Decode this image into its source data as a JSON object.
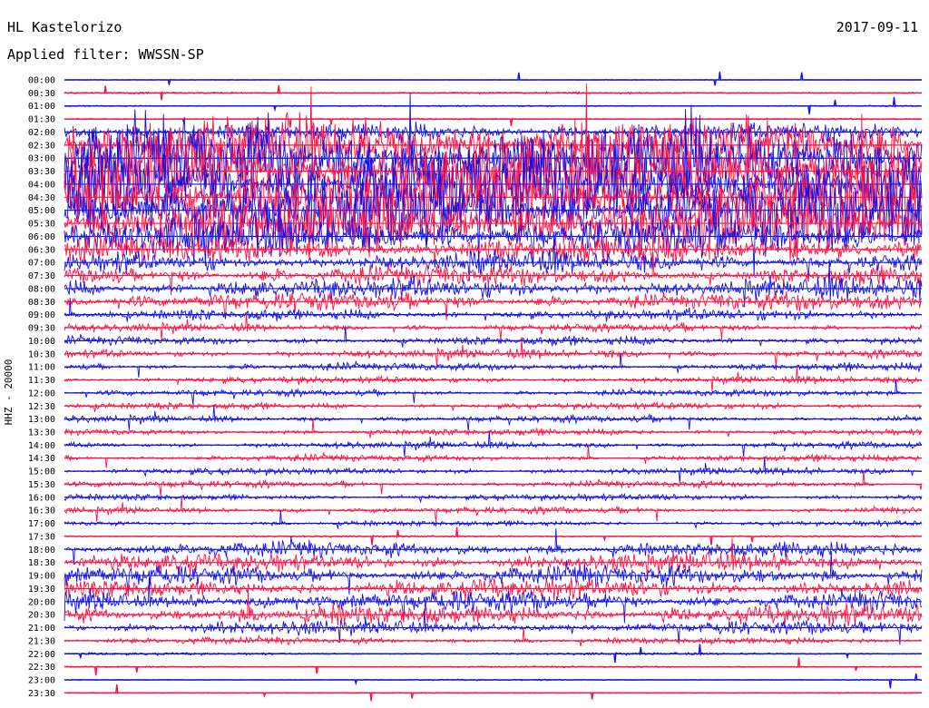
{
  "header": {
    "station": "HL Kastelorizo",
    "date": "2017-09-11",
    "filter": "Applied filter: WWSSN-SP"
  },
  "channel_label": "HHZ - 20000",
  "colors": {
    "blue": "#1010e8",
    "red": "#ff1040"
  },
  "chart_data": {
    "type": "line",
    "description_kind": "helicorder",
    "row_interval_minutes": 30,
    "row_labels": [
      "00:00",
      "00:30",
      "01:00",
      "01:30",
      "02:00",
      "02:30",
      "03:00",
      "03:30",
      "04:00",
      "04:30",
      "05:00",
      "05:30",
      "06:00",
      "06:30",
      "07:00",
      "07:30",
      "08:00",
      "08:30",
      "09:00",
      "09:30",
      "10:00",
      "10:30",
      "11:00",
      "11:30",
      "12:00",
      "12:30",
      "13:00",
      "13:30",
      "14:00",
      "14:30",
      "15:00",
      "15:30",
      "16:00",
      "16:30",
      "17:00",
      "17:30",
      "18:00",
      "18:30",
      "19:00",
      "19:30",
      "20:00",
      "20:30",
      "21:00",
      "21:30",
      "22:00",
      "22:30",
      "23:00",
      "23:30"
    ],
    "series": [
      {
        "color": "blue",
        "rows": "even-index rows (00:00, 01:00, ...)"
      },
      {
        "color": "red",
        "rows": "odd-index rows (00:30, 01:30, ...)"
      }
    ],
    "relative_amplitude": [
      0.02,
      0.06,
      0.04,
      0.05,
      0.8,
      2.4,
      3.4,
      3.6,
      3.6,
      3.4,
      3.2,
      2.8,
      1.8,
      1.2,
      0.9,
      0.9,
      0.9,
      0.8,
      0.5,
      0.35,
      0.4,
      0.4,
      0.35,
      0.3,
      0.3,
      0.3,
      0.3,
      0.3,
      0.3,
      0.3,
      0.3,
      0.3,
      0.3,
      0.3,
      0.25,
      0.06,
      0.7,
      0.8,
      0.9,
      0.9,
      0.95,
      0.9,
      0.6,
      0.3,
      0.08,
      0.05,
      0.04,
      0.03
    ],
    "grid": false
  }
}
